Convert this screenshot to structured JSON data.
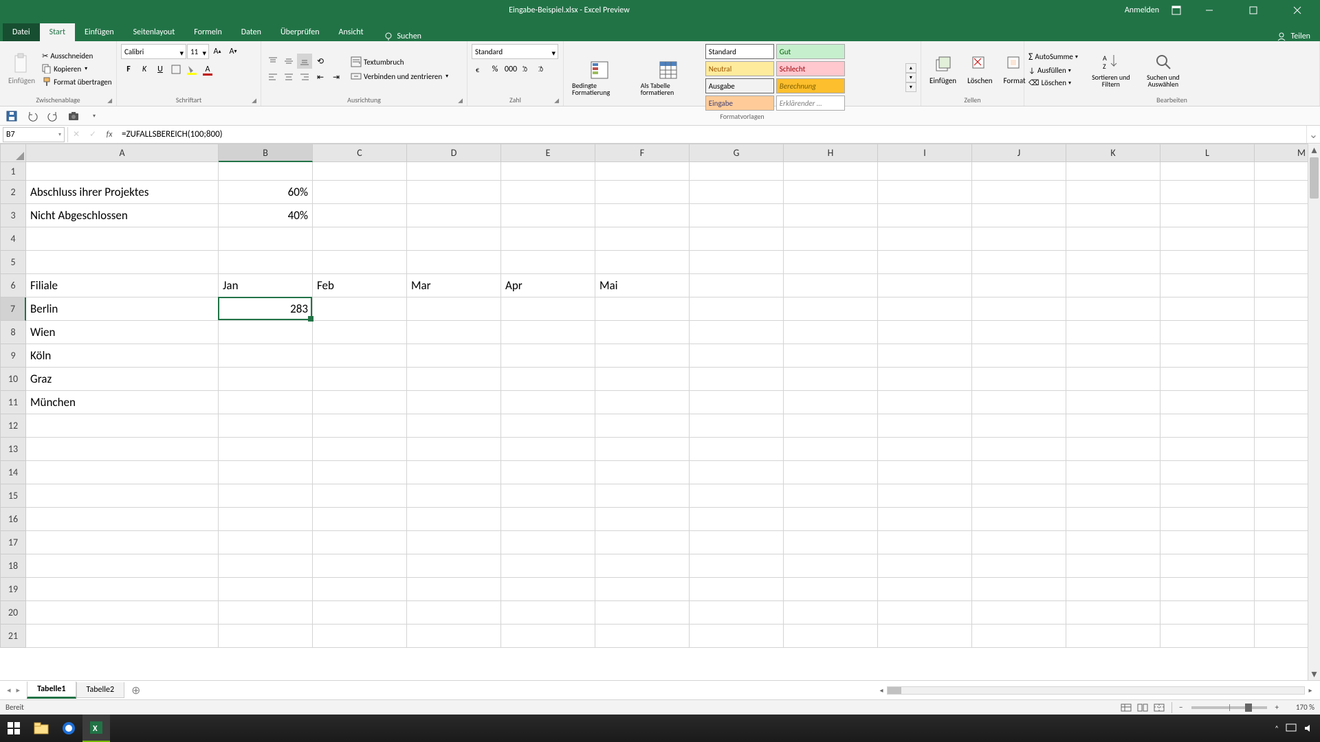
{
  "title": "Eingabe-Beispiel.xlsx - Excel Preview",
  "signin": "Anmelden",
  "menu": {
    "file": "Datei",
    "tabs": [
      "Start",
      "Einfügen",
      "Seitenlayout",
      "Formeln",
      "Daten",
      "Überprüfen",
      "Ansicht"
    ],
    "search_placeholder": "Suchen",
    "share": "Teilen"
  },
  "ribbon": {
    "clipboard": {
      "paste": "Einfügen",
      "cut": "Ausschneiden",
      "copy": "Kopieren",
      "format_painter": "Format übertragen",
      "group": "Zwischenablage"
    },
    "font": {
      "name": "Calibri",
      "size": "11",
      "group": "Schriftart"
    },
    "alignment": {
      "wrap": "Textumbruch",
      "merge": "Verbinden und zentrieren",
      "group": "Ausrichtung"
    },
    "number": {
      "format": "Standard",
      "group": "Zahl"
    },
    "styles": {
      "cond": "Bedingte Formatierung",
      "table": "Als Tabelle formatieren",
      "cells": {
        "standard": "Standard",
        "gut": "Gut",
        "neutral": "Neutral",
        "schlecht": "Schlecht",
        "ausgabe": "Ausgabe",
        "berechnung": "Berechnung",
        "eingabe": "Eingabe",
        "erklar": "Erklärender …"
      },
      "group": "Formatvorlagen"
    },
    "cells_grp": {
      "insert": "Einfügen",
      "delete": "Löschen",
      "format": "Format",
      "group": "Zellen"
    },
    "editing": {
      "autosum": "AutoSumme",
      "fill": "Ausfüllen",
      "clear": "Löschen",
      "sort": "Sortieren und Filtern",
      "find": "Suchen und Auswählen",
      "group": "Bearbeiten"
    }
  },
  "formula": {
    "name_box": "B7",
    "value": "=ZUFALLSBEREICH(100;800)"
  },
  "grid": {
    "col_widths": {
      "A": 280,
      "other": 137
    },
    "col_letters": [
      "A",
      "B",
      "C",
      "D",
      "E",
      "F",
      "G",
      "H",
      "I",
      "J",
      "K",
      "L",
      "M"
    ],
    "row_numbers": [
      1,
      2,
      3,
      4,
      5,
      6,
      7,
      8,
      9,
      10,
      11,
      12,
      13,
      14,
      15,
      16,
      17,
      18,
      19,
      20,
      21
    ],
    "selected_cell": "B7",
    "data": {
      "1": {},
      "2": {
        "A": "Abschluss ihrer Projektes",
        "B": "60%"
      },
      "3": {
        "A": "Nicht Abgeschlossen",
        "B": "40%"
      },
      "4": {},
      "5": {},
      "6": {
        "A": "Filiale",
        "B": "Jan",
        "C": "Feb",
        "D": "Mar",
        "E": "Apr",
        "F": "Mai"
      },
      "7": {
        "A": "Berlin",
        "B": "283"
      },
      "8": {
        "A": "Wien"
      },
      "9": {
        "A": "Köln"
      },
      "10": {
        "A": "Graz"
      },
      "11": {
        "A": "München"
      }
    }
  },
  "sheets": {
    "tabs": [
      "Tabelle1",
      "Tabelle2"
    ],
    "active": 0
  },
  "status": {
    "ready": "Bereit",
    "zoom": "170 %"
  },
  "taskbar": {
    "time": "",
    "date": ""
  }
}
